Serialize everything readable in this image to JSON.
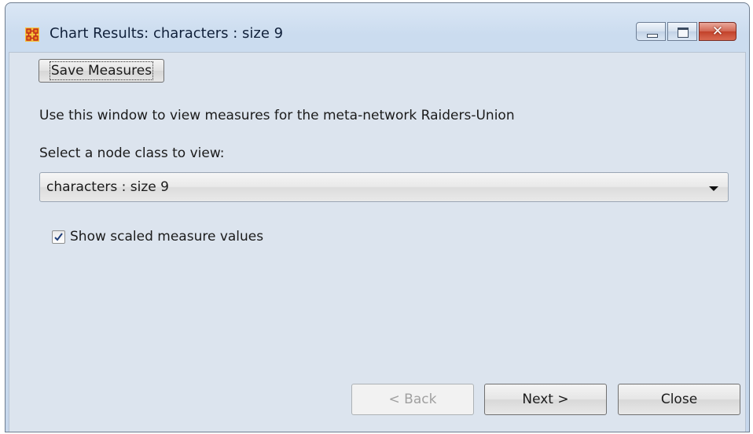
{
  "window": {
    "title": "Chart Results: characters : size 9",
    "app_icon": "network-grid-icon",
    "controls": [
      "minimize-icon",
      "maximize-icon",
      "close-icon"
    ]
  },
  "toolbar": {
    "save_label": "Save Measures"
  },
  "main": {
    "description": "Use this window to view measures for the meta-network Raiders-Union",
    "select_label": "Select a node class to view:",
    "node_class": {
      "selected": "characters : size 9"
    },
    "scaled_checkbox": {
      "label": "Show scaled measure values",
      "checked": true
    }
  },
  "footer": {
    "back_label": "< Back",
    "next_label": "Next >",
    "close_label": "Close"
  },
  "colors": {
    "accent_close": "#c2412a",
    "app_icon_orange": "#f0a020",
    "app_icon_red": "#d22"
  }
}
